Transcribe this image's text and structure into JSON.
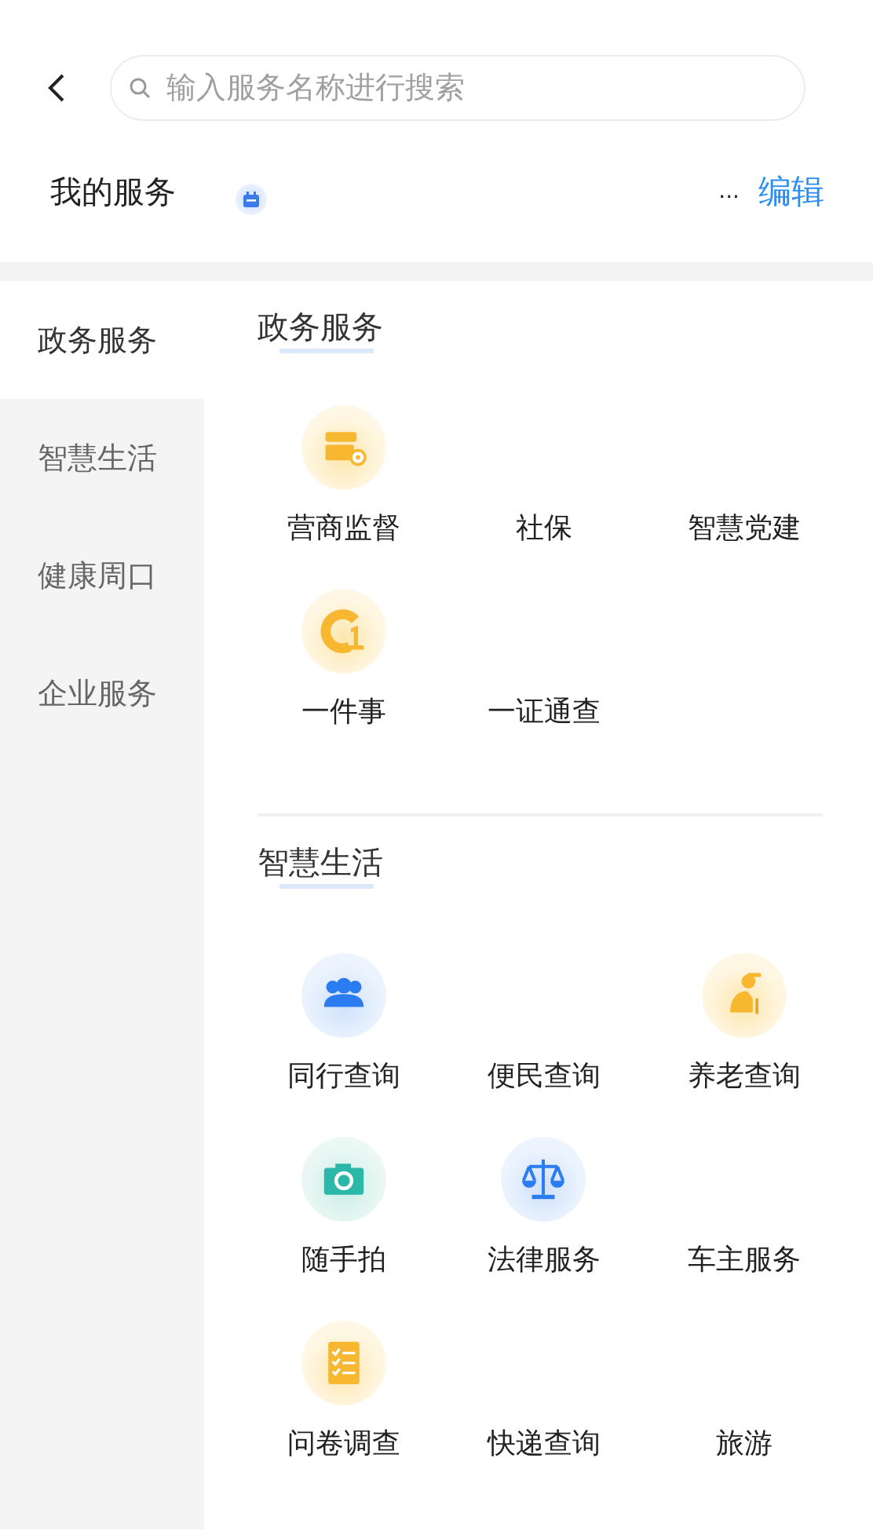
{
  "search": {
    "placeholder": "输入服务名称进行搜索"
  },
  "my_services": {
    "title": "我的服务",
    "more": "...",
    "edit": "编辑"
  },
  "sidebar": {
    "items": [
      {
        "label": "政务服务",
        "selected": true
      },
      {
        "label": "智慧生活",
        "selected": false
      },
      {
        "label": "健康周口",
        "selected": false
      },
      {
        "label": "企业服务",
        "selected": false
      }
    ]
  },
  "sections": [
    {
      "title": "政务服务",
      "items": [
        {
          "label": "营商监督",
          "kind": "store"
        },
        {
          "label": "社保",
          "kind": "plain"
        },
        {
          "label": "智慧党建",
          "kind": "plain"
        },
        {
          "label": "一件事",
          "kind": "one"
        },
        {
          "label": "一证通查",
          "kind": "plain"
        }
      ]
    },
    {
      "title": "智慧生活",
      "items": [
        {
          "label": "同行查询",
          "kind": "people"
        },
        {
          "label": "便民查询",
          "kind": "plain"
        },
        {
          "label": "养老查询",
          "kind": "elder"
        },
        {
          "label": "随手拍",
          "kind": "camera"
        },
        {
          "label": "法律服务",
          "kind": "scale"
        },
        {
          "label": "车主服务",
          "kind": "plain"
        },
        {
          "label": "问卷调查",
          "kind": "survey"
        },
        {
          "label": "快递查询",
          "kind": "plain"
        },
        {
          "label": "旅游",
          "kind": "plain"
        }
      ]
    }
  ]
}
